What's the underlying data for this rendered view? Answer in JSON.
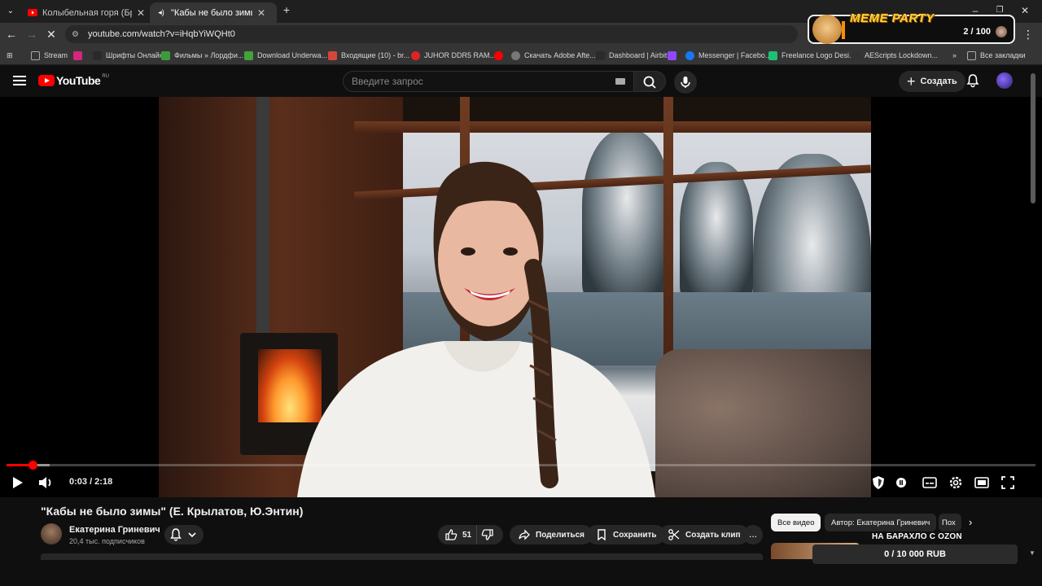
{
  "browser": {
    "tabs": [
      {
        "title": "Колыбельная горя (Бруксы) О",
        "active": false
      },
      {
        "title": "\"Кабы не было зимы\" (Е. К",
        "active": true
      }
    ],
    "new_tab": "+",
    "url": "youtube.com/watch?v=iHqbYiWQHt0",
    "bookmarks": [
      {
        "label": "Stream",
        "color": "#8a8a8a"
      },
      {
        "label": "",
        "color": "#d4267d"
      },
      {
        "label": "Шрифты Онлайн",
        "color": "#222222"
      },
      {
        "label": "Фильмы » Лордфи...",
        "color": "#3b9b3b"
      },
      {
        "label": "Download Underwa...",
        "color": "#41a33a"
      },
      {
        "label": "Входящие (10) - br...",
        "color": "#d44638"
      },
      {
        "label": "JUHOR DDR5 RAM...",
        "color": "#e02424"
      },
      {
        "label": "",
        "color": "#ff0000"
      },
      {
        "label": "Скачать Adobe Afte...",
        "color": "#777777"
      },
      {
        "label": "Dashboard | Airbit",
        "color": "#2b2b2b"
      },
      {
        "label": "",
        "color": "#9146ff"
      },
      {
        "label": "Messenger | Facebo...",
        "color": "#1877f2"
      },
      {
        "label": "Freelance Logo Desi...",
        "color": "#1dbf73"
      },
      {
        "label": "AEScripts Lockdown...",
        "color": "#333333"
      }
    ],
    "all_bookmarks": "Все закладки"
  },
  "youtube": {
    "logo_text": "YouTube",
    "logo_region": "RU",
    "search_placeholder": "Введите запрос",
    "create_label": "Создать",
    "player": {
      "time": "0:03 / 2:18",
      "played_fraction": 0.025,
      "loaded_fraction": 0.042
    },
    "video_title": "\"Кабы не было зимы\" (Е. Крылатов, Ю.Энтин)",
    "channel_name": "Екатерина Гриневич",
    "subscribers": "20,4 тыс. подписчиков",
    "likes": "51",
    "actions": {
      "share": "Поделиться",
      "save": "Сохранить",
      "clip": "Создать клип",
      "more": "..."
    },
    "chips": [
      "Все видео",
      "Автор: Екатерина Гриневич",
      "Пох"
    ]
  },
  "overlays": {
    "meme_title": "MEME PARTY",
    "meme_count": "2 / 100",
    "ozon_title": "НА БАРАХЛО С OZON",
    "ozon_amount": "0 / 10 000 RUB"
  },
  "colors": {
    "accent": "#ff0000",
    "meme": "#ffd23a"
  }
}
